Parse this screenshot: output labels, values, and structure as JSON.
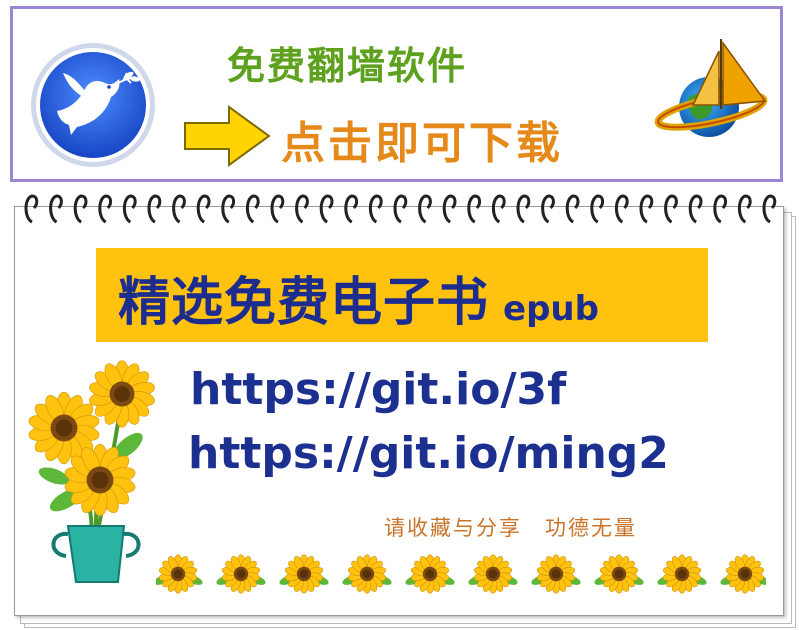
{
  "top_banner": {
    "title": "免费翻墙软件",
    "subtitle": "点击即可下载",
    "left_logo_icon": "dove-icon",
    "right_logo_icon": "globe-sailboat-icon",
    "arrow_icon": "arrow-right-icon"
  },
  "book_banner": {
    "title": "精选免费电子书",
    "format": "epub"
  },
  "links": [
    "https://git.io/3f",
    "https://git.io/ming2"
  ],
  "footer_note": "请收藏与分享　功德无量",
  "colors": {
    "banner_border": "#9b86d6",
    "title_green": "#5ea11f",
    "subtitle_orange": "#e58a1a",
    "book_banner_bg": "#ffc20e",
    "book_title_blue": "#1c2d8f",
    "link_blue": "#1c3090",
    "footer_brown": "#c9742a"
  }
}
